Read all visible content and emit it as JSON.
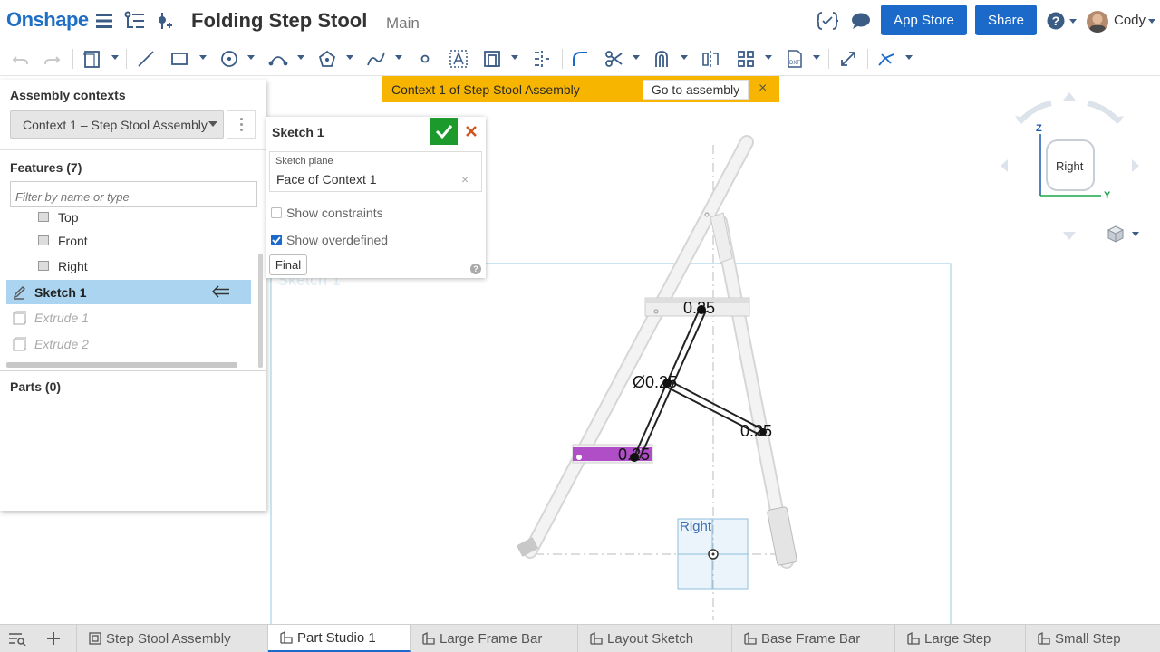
{
  "header": {
    "logo": "Onshape",
    "doc_title": "Folding Step Stool",
    "branch": "Main",
    "app_store": "App Store",
    "share": "Share",
    "user": "Cody"
  },
  "left_panel": {
    "assembly_contexts_heading": "Assembly contexts",
    "context_selected": "Context 1 – Step Stool Assembly",
    "features_heading": "Features (7)",
    "filter_placeholder": "Filter by name or type",
    "features": [
      {
        "label": "Top"
      },
      {
        "label": "Front"
      },
      {
        "label": "Right"
      },
      {
        "label": "Sketch 1"
      },
      {
        "label": "Extrude 1"
      },
      {
        "label": "Extrude 2"
      }
    ],
    "parts_heading": "Parts (0)"
  },
  "sketch_dialog": {
    "title": "Sketch 1",
    "plane_label": "Sketch plane",
    "plane_value": "Face of Context 1",
    "plane_clear": "×",
    "show_constraints": "Show constraints",
    "show_overdefined": "Show overdefined",
    "final": "Final",
    "help": "?"
  },
  "banner": {
    "text": "Context 1 of Step Stool Assembly",
    "button": "Go to assembly",
    "close": "×"
  },
  "viewport": {
    "sketch_watermark": "Sketch 1",
    "dims": {
      "d1": "0.25",
      "d2": "Ø0.25",
      "d3": "0.25",
      "d4": "0.25"
    },
    "right_plane_label": "Right"
  },
  "view_cube": {
    "face": "Right",
    "axis_z": "Z",
    "axis_y": "Y"
  },
  "tabs": [
    {
      "label": "Step Stool Assembly"
    },
    {
      "label": "Part Studio 1"
    },
    {
      "label": "Large Frame Bar"
    },
    {
      "label": "Layout Sketch"
    },
    {
      "label": "Base Frame Bar"
    },
    {
      "label": "Large Step"
    },
    {
      "label": "Small Step"
    }
  ],
  "colors": {
    "brand_blue": "#1b6ac9",
    "banner_yellow": "#f7b500",
    "ok_green": "#1d9a2c",
    "selection_blue": "#aad4f0",
    "magenta": "#b04ec8"
  }
}
